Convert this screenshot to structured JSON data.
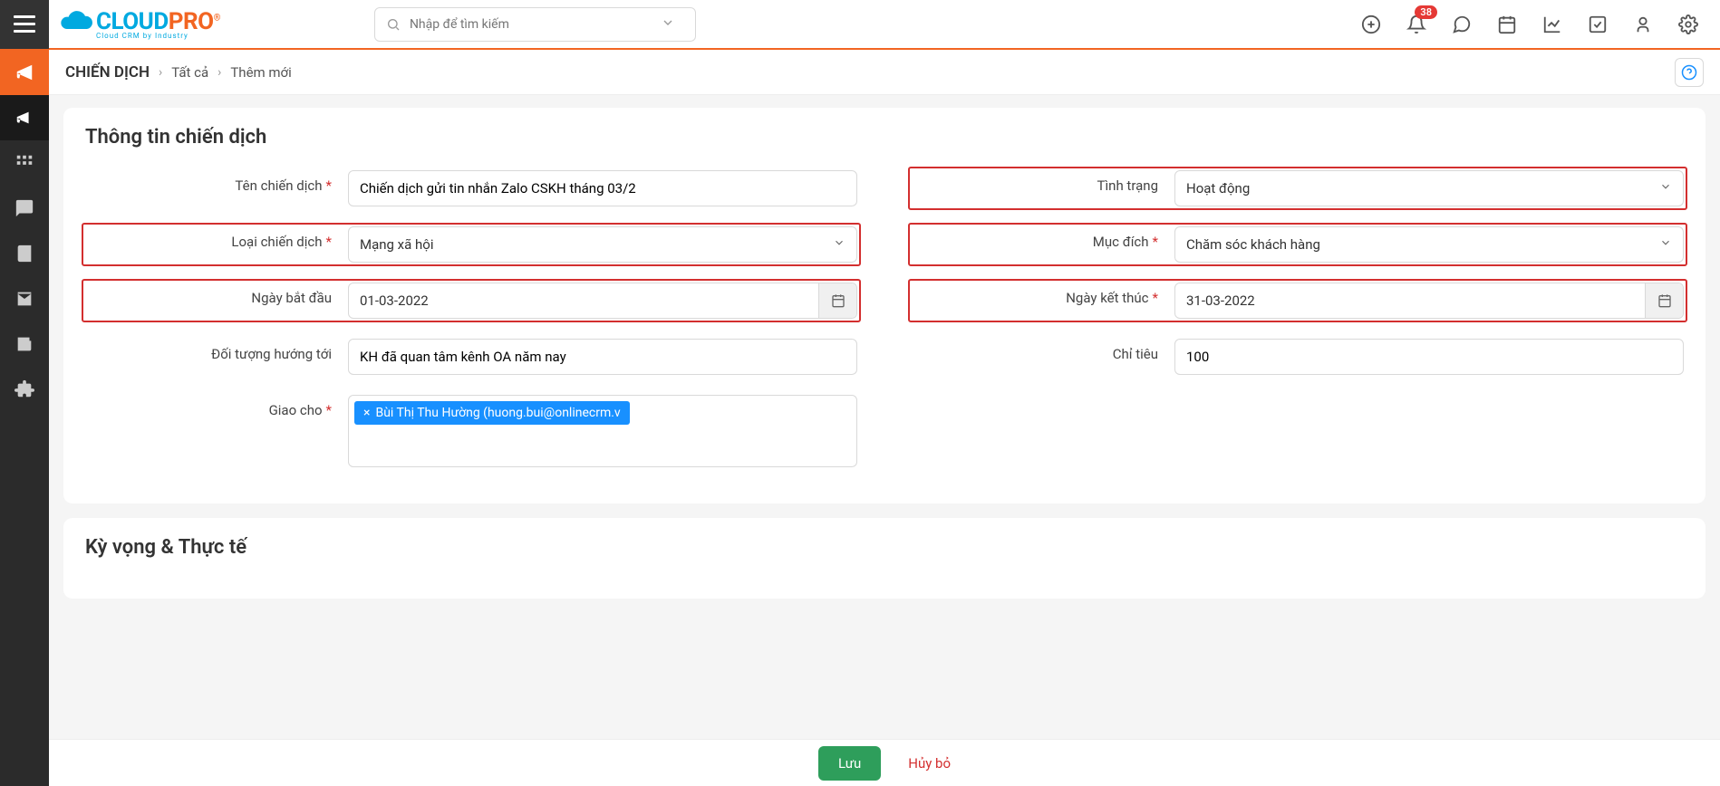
{
  "header": {
    "logo_main": "CLOUD",
    "logo_accent": "PRO",
    "logo_sub": "Cloud CRM by Industry",
    "search_placeholder": "Nhập để tìm kiếm",
    "notification_count": "38"
  },
  "breadcrumb": {
    "root": "CHIẾN DỊCH",
    "level1": "Tất cả",
    "level2": "Thêm mới"
  },
  "section1": {
    "title": "Thông tin chiến dịch",
    "fields": {
      "campaign_name": {
        "label": "Tên chiến dịch",
        "value": "Chiến dịch gửi tin nhắn Zalo CSKH tháng 03/2"
      },
      "status": {
        "label": "Tình trạng",
        "value": "Hoạt động"
      },
      "campaign_type": {
        "label": "Loại chiến dịch",
        "value": "Mạng xã hội"
      },
      "purpose": {
        "label": "Mục đích",
        "value": "Chăm sóc khách hàng"
      },
      "start_date": {
        "label": "Ngày bắt đầu",
        "value": "01-03-2022"
      },
      "end_date": {
        "label": "Ngày kết thúc",
        "value": "31-03-2022"
      },
      "target_audience": {
        "label": "Đối tượng hướng tới",
        "value": "KH đã quan tâm kênh OA năm nay"
      },
      "target_metric": {
        "label": "Chỉ tiêu",
        "value": "100"
      },
      "assigned_to": {
        "label": "Giao cho",
        "tag": "Bùi Thị Thu Hường (huong.bui@onlinecrm.v"
      }
    }
  },
  "section2": {
    "title": "Kỳ vọng & Thực tế"
  },
  "footer": {
    "save": "Lưu",
    "cancel": "Hủy bỏ"
  }
}
